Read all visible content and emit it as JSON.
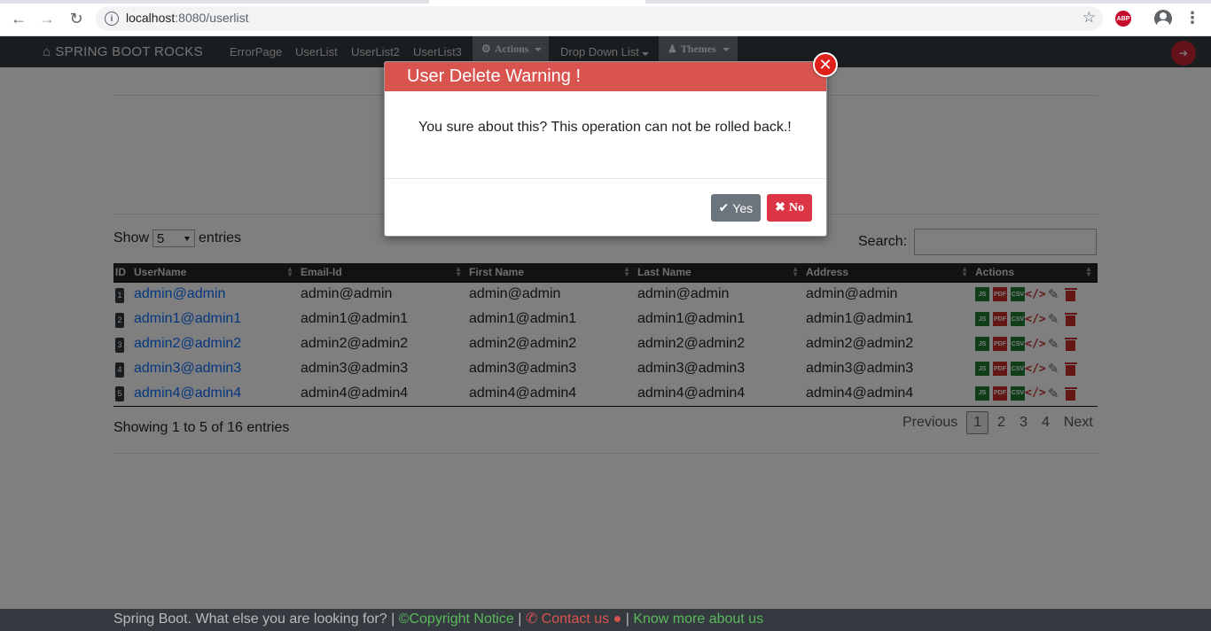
{
  "browser": {
    "url_host": "localhost",
    "url_path": ":8080/userlist",
    "info_glyph": "i",
    "abp_label": "ABP"
  },
  "navbar": {
    "brand": "SPRING BOOT ROCKS",
    "links": [
      "ErrorPage",
      "UserList",
      "UserList2",
      "UserList3"
    ],
    "actions_label": "Actions",
    "dropdown_label": "Drop Down List",
    "themes_label": "Themes"
  },
  "table": {
    "show_label": "Show",
    "page_size": "5",
    "entries_label": "entries",
    "search_label": "Search:",
    "columns": [
      "ID",
      "UserName",
      "Email-Id",
      "First Name",
      "Last Name",
      "Address",
      "Actions"
    ],
    "rows": [
      {
        "id": "1",
        "username": "admin@admin",
        "email": "admin@admin",
        "first": "admin@admin",
        "last": "admin@admin",
        "address": "admin@admin"
      },
      {
        "id": "2",
        "username": "admin1@admin1",
        "email": "admin1@admin1",
        "first": "admin1@admin1",
        "last": "admin1@admin1",
        "address": "admin1@admin1"
      },
      {
        "id": "3",
        "username": "admin2@admin2",
        "email": "admin2@admin2",
        "first": "admin2@admin2",
        "last": "admin2@admin2",
        "address": "admin2@admin2"
      },
      {
        "id": "4",
        "username": "admin3@admin3",
        "email": "admin3@admin3",
        "first": "admin3@admin3",
        "last": "admin3@admin3",
        "address": "admin3@admin3"
      },
      {
        "id": "5",
        "username": "admin4@admin4",
        "email": "admin4@admin4",
        "first": "admin4@admin4",
        "last": "admin4@admin4",
        "address": "admin4@admin4"
      }
    ],
    "icon_labels": {
      "js": "JS",
      "pdf": "PDF",
      "csv": "CSV"
    },
    "showing": "Showing 1 to 5 of 16 entries",
    "pager": {
      "previous": "Previous",
      "pages": [
        "1",
        "2",
        "3",
        "4"
      ],
      "active_page": "1",
      "next": "Next"
    }
  },
  "modal": {
    "title": "User Delete Warning !",
    "message": "You sure about this? This operation can not be rolled back.!",
    "yes_label": "Yes",
    "no_label": "No"
  },
  "footer": {
    "text": "Spring Boot. What else you are looking for? |",
    "copyright": "Copyright Notice",
    "sep1": "|",
    "contact": "Contact us",
    "sep2": "|",
    "know_more": "Know more about us"
  },
  "colors": {
    "navbar": "#343a40",
    "modal_header": "#d9534f",
    "link": "#0d6efd",
    "success": "#5cb85c",
    "danger": "#d9534f"
  }
}
